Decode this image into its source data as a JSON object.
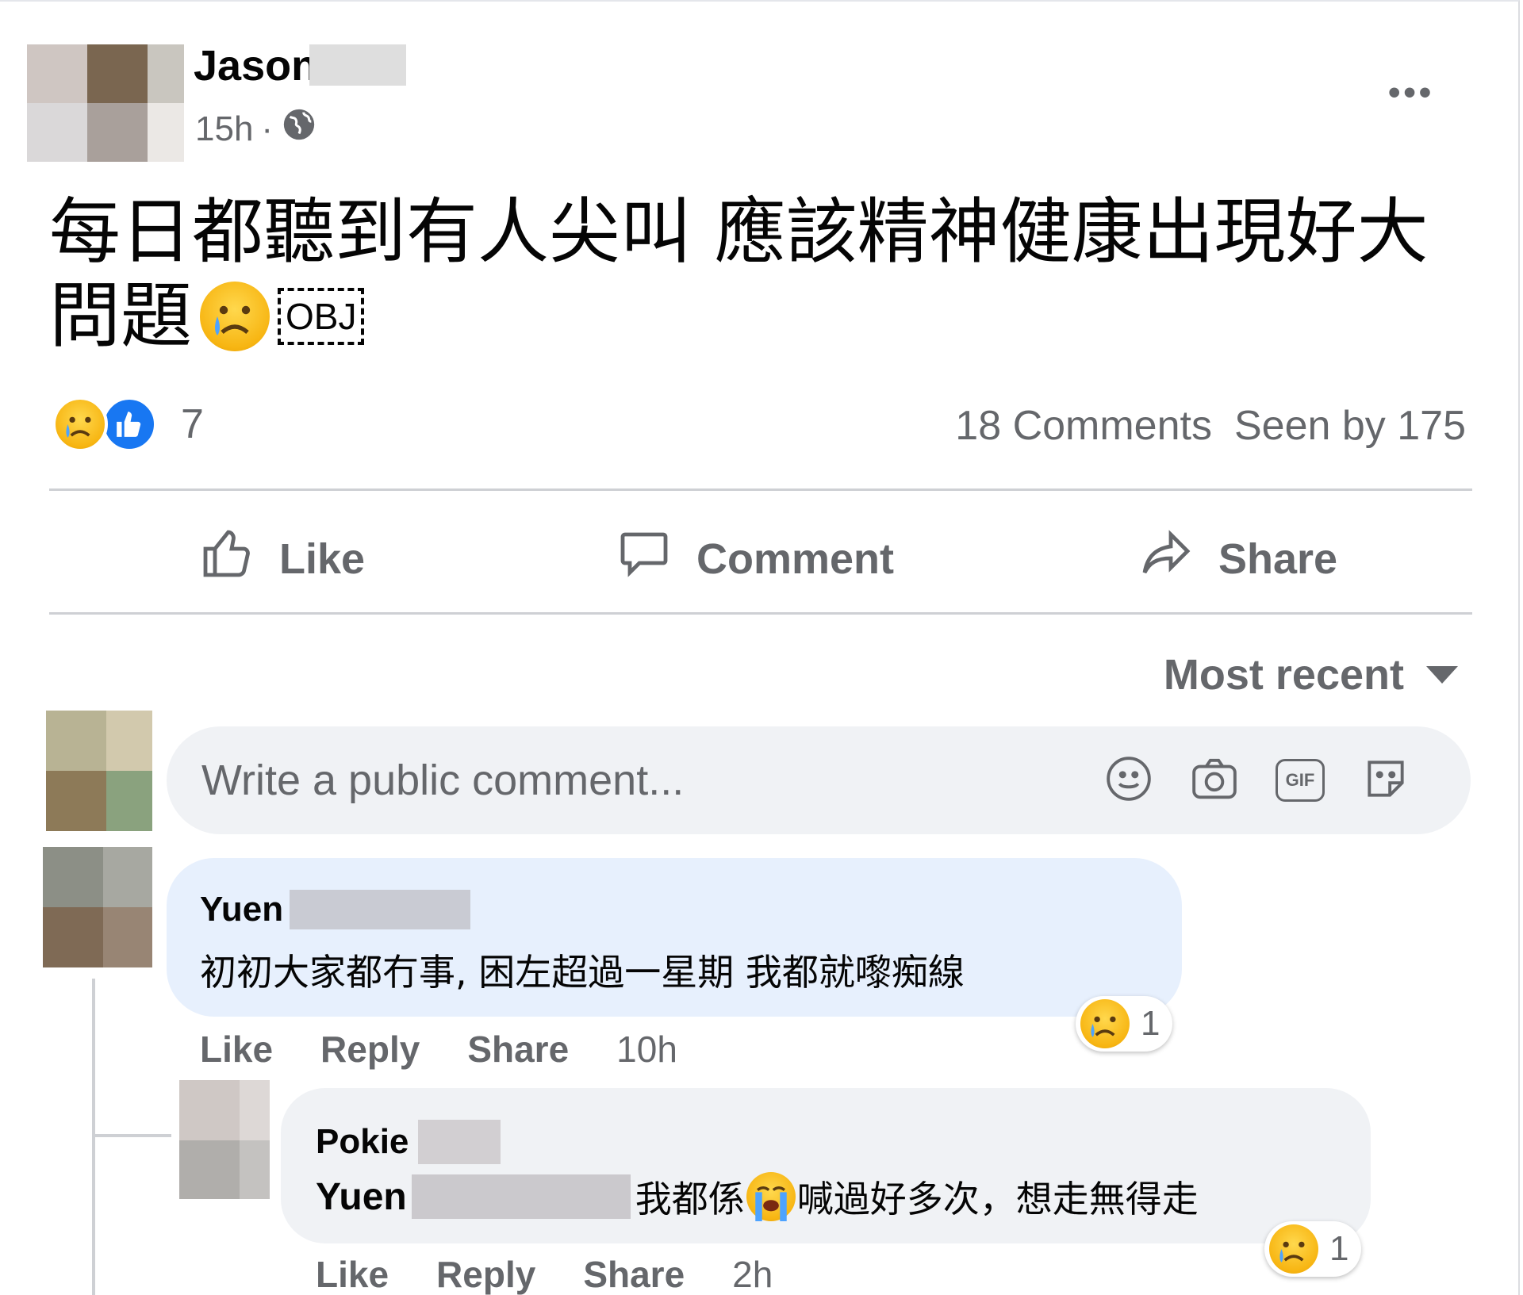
{
  "post": {
    "author_first_name": "Jason",
    "timestamp": "15h",
    "separator": "·",
    "audience_icon": "globe-icon",
    "more_icon": "more-options-icon",
    "more_label": "•••",
    "text_line1": "每日都聽到有人尖叫 應該精神健康出現好大",
    "text_line2": "問題",
    "obj_label": "OBJ",
    "reaction_icons": [
      "crying-emoji-icon",
      "like-reaction-icon"
    ],
    "reaction_count": "7",
    "comments_count": "18 Comments",
    "seen_by": "Seen by 175"
  },
  "actions": {
    "like_label": "Like",
    "comment_label": "Comment",
    "share_label": "Share"
  },
  "comments_section": {
    "sort_label": "Most recent",
    "composer_placeholder": "Write a public comment...",
    "composer_icons": [
      "emoji-icon",
      "camera-icon",
      "gif-icon",
      "sticker-icon"
    ],
    "gif_label": "GIF"
  },
  "comments": [
    {
      "author_first_name": "Yuen",
      "text": "初初大家都冇事, 困左超過一星期 我都就嚟痴線",
      "reaction_count": "1",
      "links": {
        "like": "Like",
        "reply": "Reply",
        "share": "Share"
      },
      "time": "10h"
    },
    {
      "author_first_name": "Pokie",
      "mention_first_name": "Yuen",
      "text_before_emoji": "我都係",
      "text_after_emoji": "喊過好多次，想走無得走",
      "reaction_count": "1",
      "links": {
        "like": "Like",
        "reply": "Reply",
        "share": "Share"
      },
      "time": "2h"
    }
  ],
  "colors": {
    "primary_text": "#050505",
    "secondary_text": "#65676b",
    "facebook_blue": "#1877f2",
    "comment_bubble_highlight": "#e7f0fd",
    "comment_bubble": "#f0f2f5",
    "divider": "#ced0d4"
  }
}
